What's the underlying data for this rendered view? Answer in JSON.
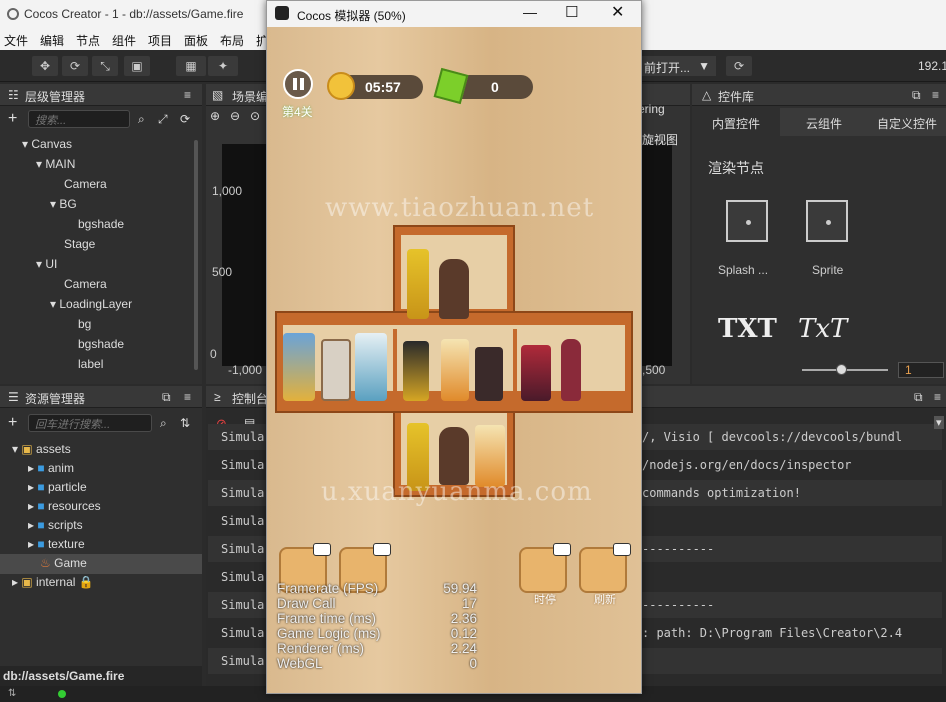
{
  "app": {
    "title": "Cocos Creator - 1 - db://assets/Game.fire"
  },
  "menu": [
    "文件",
    "编辑",
    "节点",
    "组件",
    "项目",
    "面板",
    "布局",
    "扩"
  ],
  "toolbar": {
    "open_text": "前打开...",
    "ip": "192.1"
  },
  "hierarchy": {
    "title": "层级管理器",
    "search_placeholder": "搜索...",
    "nodes": [
      "Canvas",
      "MAIN",
      "Camera",
      "BG",
      "bgshade",
      "Stage",
      "UI",
      "Camera",
      "LoadingLayer",
      "bg",
      "bgshade",
      "label"
    ]
  },
  "scene": {
    "title": "场景编",
    "ticks": [
      "1,000",
      "500",
      "0",
      "-1,000"
    ],
    "right_labels": [
      "ering",
      "旋视图"
    ],
    "bottom_tick": ",500"
  },
  "assets": {
    "title": "资源管理器",
    "search_placeholder": "回车进行搜索...",
    "items": [
      "assets",
      "anim",
      "particle",
      "resources",
      "scripts",
      "texture",
      "Game",
      "internal"
    ],
    "path": "db://assets/Game.fire"
  },
  "console": {
    "title": "控制台",
    "lines": [
      "Simula",
      "Simula",
      "Simula",
      "Simula",
      "Simula",
      "Simula",
      "Simula",
      "Simula",
      "Simula"
    ],
    "right_lines": [
      "/, Visio [ devcools://devcools/bundl",
      "/nodejs.org/en/docs/inspector",
      "commands optimization!",
      "",
      "----------",
      "",
      "----------",
      ": path: D:\\Program Files\\Creator\\2.4",
      ""
    ]
  },
  "library": {
    "title": "控件库",
    "tabs": [
      "内置控件",
      "云组件",
      "自定义控件"
    ],
    "section": "渲染节点",
    "items": [
      "Splash ...",
      "Sprite"
    ],
    "txt1": "TXT",
    "txt2": "TxT",
    "slider_value": "1"
  },
  "simulator": {
    "title": "Cocos 模拟器 (50%)",
    "timer": "05:57",
    "score": "0",
    "level": "第4关",
    "buttons": [
      "",
      "",
      "时停",
      "刷新"
    ],
    "watermarks": [
      "www.tiaozhuan.net",
      "u.xuanyuanma.com"
    ]
  },
  "stats": [
    [
      "Framerate (FPS)",
      "59.94"
    ],
    [
      "Draw Call",
      "17"
    ],
    [
      "Frame time (ms)",
      "2.36"
    ],
    [
      "Game Logic (ms)",
      "0.12"
    ],
    [
      "Renderer (ms)",
      "2.24"
    ],
    [
      "WebGL",
      "0"
    ]
  ]
}
